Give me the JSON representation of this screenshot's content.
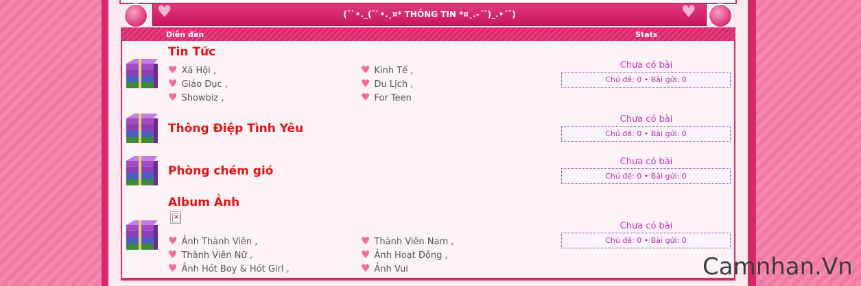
{
  "header": {
    "title": "(¯`•._(¯`•.¸¤* THÔNG TIN *¤¸.-´¯)_.•´¯)"
  },
  "columns": {
    "forum": "Diễn đàn",
    "stats": "Stats"
  },
  "forums": [
    {
      "title": "Tin Tức",
      "subforums": [
        "Xã Hội",
        "Kinh Tế",
        "Giáo Dục",
        "Du Lịch",
        "Showbiz",
        "For Teen"
      ],
      "stats_link": "Chưa có bài",
      "stats_text": "Chủ đề: 0 • Bài gửi: 0"
    },
    {
      "title": "Thông Điệp Tình Yêu",
      "subforums": [],
      "stats_link": "Chưa có bài",
      "stats_text": "Chủ đề: 0 • Bài gửi: 0"
    },
    {
      "title": "Phòng chém gió",
      "subforums": [],
      "stats_link": "Chưa có bài",
      "stats_text": "Chủ đề: 0 • Bài gửi: 0"
    },
    {
      "title": "Album Ảnh",
      "subforums": [
        "Ảnh Thành Viên",
        "Thành Viên Nam",
        "Thành Viên Nữ",
        "Ảnh Hoạt Động",
        "Ảnh Hót Boy & Hót Girl",
        "Ảnh Vui"
      ],
      "stats_link": "Chưa có bài",
      "stats_text": "Chủ đề: 0 • Bài gửi: 0"
    }
  ],
  "separator": ",",
  "watermark": "Camnhan.Vn",
  "colors": {
    "frame": "#d8286c",
    "title": "#e01414",
    "stats": "#c032c8"
  },
  "icons": {
    "forum_icon": "book-stack-icon",
    "bullet": "heart-icon",
    "broken_image": "broken-image-icon"
  }
}
